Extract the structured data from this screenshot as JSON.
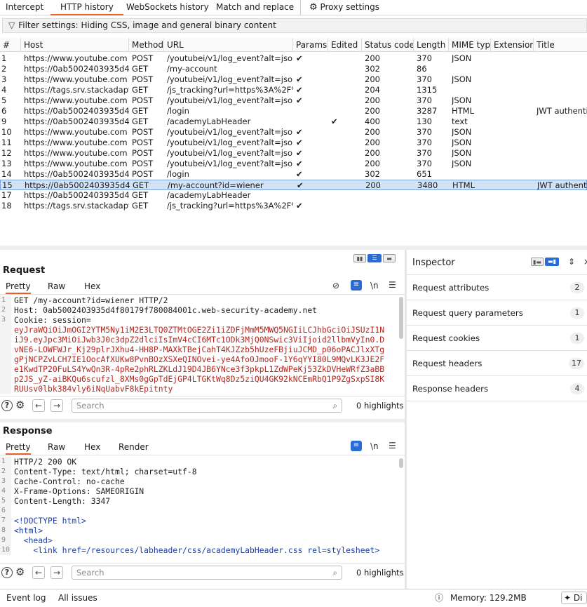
{
  "top_tabs": [
    "Intercept",
    "HTTP history",
    "WebSockets history",
    "Match and replace",
    "Proxy settings"
  ],
  "filter": {
    "label": "Filter settings: Hiding CSS, image and general binary content"
  },
  "columns": [
    "#",
    "Host",
    "Method",
    "URL",
    "Params",
    "Edited",
    "Status code",
    "Length",
    "MIME type",
    "Extension",
    "Title"
  ],
  "rows": [
    {
      "n": "1",
      "host": "https://www.youtube.com",
      "method": "POST",
      "url": "/youtubei/v1/log_event?alt=json",
      "params": "✔",
      "edited": "",
      "status": "200",
      "length": "370",
      "mime": "JSON",
      "ext": "",
      "title": ""
    },
    {
      "n": "2",
      "host": "https://0ab5002403935d4f...",
      "method": "GET",
      "url": "/my-account",
      "params": "",
      "edited": "",
      "status": "302",
      "length": "86",
      "mime": "",
      "ext": "",
      "title": ""
    },
    {
      "n": "3",
      "host": "https://www.youtube.com",
      "method": "POST",
      "url": "/youtubei/v1/log_event?alt=json",
      "params": "✔",
      "edited": "",
      "status": "200",
      "length": "370",
      "mime": "JSON",
      "ext": "",
      "title": ""
    },
    {
      "n": "4",
      "host": "https://tags.srv.stackadapt.c...",
      "method": "GET",
      "url": "/js_tracking?url=https%3A%2F%2...",
      "params": "✔",
      "edited": "",
      "status": "204",
      "length": "1315",
      "mime": "",
      "ext": "",
      "title": ""
    },
    {
      "n": "5",
      "host": "https://www.youtube.com",
      "method": "POST",
      "url": "/youtubei/v1/log_event?alt=json",
      "params": "✔",
      "edited": "",
      "status": "200",
      "length": "370",
      "mime": "JSON",
      "ext": "",
      "title": ""
    },
    {
      "n": "6",
      "host": "https://0ab5002403935d4f...",
      "method": "GET",
      "url": "/login",
      "params": "",
      "edited": "",
      "status": "200",
      "length": "3287",
      "mime": "HTML",
      "ext": "",
      "title": "JWT authentica"
    },
    {
      "n": "9",
      "host": "https://0ab5002403935d4f...",
      "method": "GET",
      "url": "/academyLabHeader",
      "params": "",
      "edited": "✔",
      "status": "400",
      "length": "130",
      "mime": "text",
      "ext": "",
      "title": ""
    },
    {
      "n": "10",
      "host": "https://www.youtube.com",
      "method": "POST",
      "url": "/youtubei/v1/log_event?alt=json",
      "params": "✔",
      "edited": "",
      "status": "200",
      "length": "370",
      "mime": "JSON",
      "ext": "",
      "title": ""
    },
    {
      "n": "11",
      "host": "https://www.youtube.com",
      "method": "POST",
      "url": "/youtubei/v1/log_event?alt=json",
      "params": "✔",
      "edited": "",
      "status": "200",
      "length": "370",
      "mime": "JSON",
      "ext": "",
      "title": ""
    },
    {
      "n": "12",
      "host": "https://www.youtube.com",
      "method": "POST",
      "url": "/youtubei/v1/log_event?alt=json",
      "params": "✔",
      "edited": "",
      "status": "200",
      "length": "370",
      "mime": "JSON",
      "ext": "",
      "title": ""
    },
    {
      "n": "13",
      "host": "https://www.youtube.com",
      "method": "POST",
      "url": "/youtubei/v1/log_event?alt=json",
      "params": "✔",
      "edited": "",
      "status": "200",
      "length": "370",
      "mime": "JSON",
      "ext": "",
      "title": ""
    },
    {
      "n": "14",
      "host": "https://0ab5002403935d4f...",
      "method": "POST",
      "url": "/login",
      "params": "✔",
      "edited": "",
      "status": "302",
      "length": "651",
      "mime": "",
      "ext": "",
      "title": ""
    },
    {
      "n": "15",
      "host": "https://0ab5002403935d4f...",
      "method": "GET",
      "url": "/my-account?id=wiener",
      "params": "✔",
      "edited": "",
      "status": "200",
      "length": "3480",
      "mime": "HTML",
      "ext": "",
      "title": "JWT authentica",
      "selected": true
    },
    {
      "n": "17",
      "host": "https://0ab5002403935d4f...",
      "method": "GET",
      "url": "/academyLabHeader",
      "params": "",
      "edited": "",
      "status": "",
      "length": "",
      "mime": "",
      "ext": "",
      "title": ""
    },
    {
      "n": "18",
      "host": "https://tags.srv.stackadapt.c...",
      "method": "GET",
      "url": "/js_tracking?url=https%3A%2F%2...",
      "params": "✔",
      "edited": "",
      "status": "",
      "length": "",
      "mime": "",
      "ext": "",
      "title": ""
    }
  ],
  "request": {
    "title": "Request",
    "tabs": [
      "Pretty",
      "Raw",
      "Hex"
    ],
    "line_numbers": [
      "1",
      "2",
      "3"
    ],
    "lines": [
      "GET /my-account?id=wiener HTTP/2",
      "Host: 0ab5002403935d4f80179f780084001c.web-security-academy.net",
      "Cookie: session=",
      "eyJraWQiOiJmOGI2YTM5Ny1iM2E3LTQ0ZTMtOGE2Zi1iZDFjMmM5MWQ5NGIiLCJhbGciOiJSUzI1N",
      "iJ9.eyJpc3MiOiJwb3J0c3dpZ2dlciIsImV4cCI6MTc1ODk3MjQ0NSwic3ViIjoid2llbmVyIn0.D",
      "vNE6-LOWFWJr_Kj29plrJXhu4-HH8P-MAXkTBejCahT4KJZzb5hUzeFBjiuJCMD_p06oPACJlxXTg",
      "gPjNCPZvLCH7IE1OocAfXUKw8PvnBOzXSXeQINOvei-ye4Afo0JmooF-1Y6qYYI80L9MQvLK3JE2F",
      "e1KwdTP20FuLS4YwQn3R-4pRe2phRLZKLdJ19D4JB6YNce3f3pkpL1ZdWPeKj53ZkDVHeWRfZ3aBB",
      "p2JS_yZ-aiBKQu6scufzl_8XMs0gGpTdEjGP4LTGKtWq8Dz5ziQU4GK92kNCEmRbQ1P9ZgSxpSI8K",
      "RUUsv0lbk384vly6iNqUabvF8kEpitnty"
    ],
    "search_placeholder": "Search",
    "highlights": "0 highlights"
  },
  "response": {
    "title": "Response",
    "tabs": [
      "Pretty",
      "Raw",
      "Hex",
      "Render"
    ],
    "line_numbers": [
      "1",
      "2",
      "3",
      "4",
      "5",
      "6",
      "7",
      "8",
      "9",
      "10"
    ],
    "lines": [
      "HTTP/2 200 OK",
      "Content-Type: text/html; charset=utf-8",
      "Cache-Control: no-cache",
      "X-Frame-Options: SAMEORIGIN",
      "Content-Length: 3347",
      "",
      "<!DOCTYPE html>",
      "<html>",
      "  <head>",
      "    <link href=/resources/labheader/css/academyLabHeader.css rel=stylesheet>"
    ],
    "search_placeholder": "Search",
    "highlights": "0 highlights"
  },
  "inspector": {
    "title": "Inspector",
    "sections": [
      {
        "label": "Request attributes",
        "count": "2"
      },
      {
        "label": "Request query parameters",
        "count": "1"
      },
      {
        "label": "Request cookies",
        "count": "1"
      },
      {
        "label": "Request headers",
        "count": "17"
      },
      {
        "label": "Response headers",
        "count": "4"
      }
    ]
  },
  "status_bar": {
    "event_log": "Event log",
    "all_issues": "All issues",
    "memory": "Memory: 129.2MB",
    "ai": "Di"
  },
  "colors": {
    "accent": "#e8612c",
    "selection": "#d2e3f7",
    "toggle_on": "#2a6bd6",
    "code_red": "#b5261e",
    "code_blue": "#1c3fa8"
  }
}
